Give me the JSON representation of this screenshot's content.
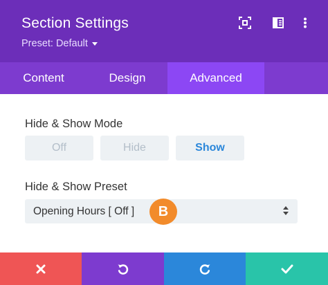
{
  "header": {
    "title": "Section Settings",
    "preset_label": "Preset: Default",
    "icons": [
      "expand-icon",
      "split-view-icon",
      "more-options-icon"
    ]
  },
  "tabs": [
    {
      "label": "Content",
      "active": false
    },
    {
      "label": "Design",
      "active": false
    },
    {
      "label": "Advanced",
      "active": true
    }
  ],
  "hide_show_mode": {
    "label": "Hide & Show Mode",
    "options": [
      "Off",
      "Hide",
      "Show"
    ],
    "selected": "Show"
  },
  "hide_show_preset": {
    "label": "Hide & Show Preset",
    "value": "Opening Hours [ Off ]"
  },
  "badge": {
    "text": "B"
  },
  "footer": {
    "buttons": [
      "cancel-icon",
      "undo-icon",
      "redo-icon",
      "save-check-icon"
    ]
  },
  "colors": {
    "header_bg": "#6c2eb9",
    "tabs_bg": "#7d3bcf",
    "active_tab": "#8c47f4",
    "accent_blue": "#2b87da",
    "cancel_red": "#ef5555",
    "save_green": "#29c4a9",
    "badge_orange": "#f28b2b"
  }
}
